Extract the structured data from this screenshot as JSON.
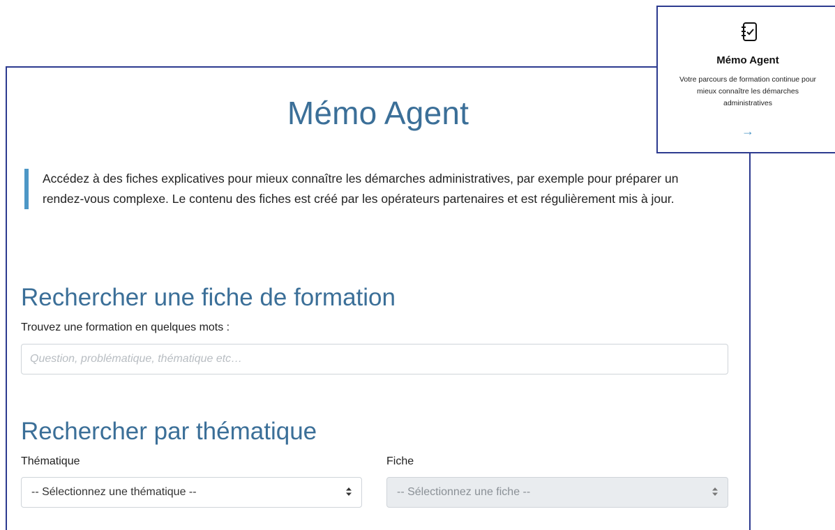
{
  "main": {
    "title": "Mémo Agent",
    "intro": "Accédez à des fiches explicatives pour mieux connaître les démarches administratives, par exemple pour préparer un rendez-vous complexe. Le contenu des fiches est créé par les opérateurs partenaires et est régulièrement mis à jour.",
    "search": {
      "heading": "Rechercher une fiche de formation",
      "label": "Trouvez une formation en quelques mots :",
      "placeholder": "Question, problématique, thématique etc…",
      "value": ""
    },
    "thematic": {
      "heading": "Rechercher par thématique",
      "theme_label": "Thématique",
      "theme_select": "-- Sélectionnez une thématique --",
      "fiche_label": "Fiche",
      "fiche_select": "-- Sélectionnez une fiche --"
    }
  },
  "card": {
    "icon": "checklist-notebook-icon",
    "title": "Mémo Agent",
    "description": "Votre parcours de formation continue pour mieux connaître les démarches administratives",
    "arrow": "→"
  },
  "colors": {
    "border": "#2c3a8f",
    "heading": "#3b6f98",
    "accent": "#4d97c6"
  }
}
